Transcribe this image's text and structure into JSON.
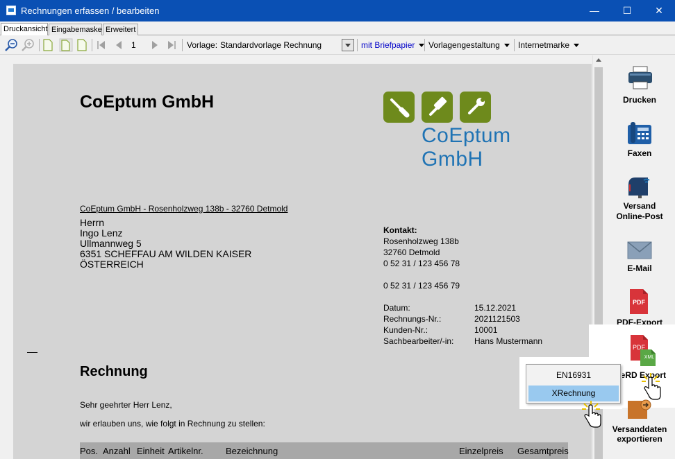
{
  "window": {
    "title": "Rechnungen erfassen / bearbeiten",
    "controls": {
      "minimize": "—",
      "maximize": "☐",
      "close": "✕"
    }
  },
  "tabs": [
    {
      "label": "Druckansicht",
      "active": true
    },
    {
      "label": "Eingabemaske",
      "active": false
    },
    {
      "label": "Erweitert",
      "active": false
    }
  ],
  "toolbar": {
    "page_number": "1",
    "vorlage_label": "Vorlage:",
    "vorlage_value": "Standardvorlage Rechnung",
    "briefpapier": "mit Briefpapier",
    "vorlagengestaltung": "Vorlagengestaltung",
    "internetmarke": "Internetmarke"
  },
  "document": {
    "company_title": "CoEptum GmbH",
    "logo_text": "CoEptum GmbH",
    "sender_line": "CoEptum GmbH - Rosenholzweg 138b - 32760 Detmold",
    "recipient": [
      "Herrn",
      "Ingo Lenz",
      "Ullmannweg 5",
      "6351 SCHEFFAU AM WILDEN KAISER",
      "ÖSTERREICH"
    ],
    "kontakt_label": "Kontakt:",
    "kontakt": [
      "Rosenholzweg 138b",
      "32760 Detmold",
      "0 52 31 / 123 456 78"
    ],
    "fax": "0 52 31 / 123 456 79",
    "details": [
      {
        "label": "Datum:",
        "value": "15.12.2021"
      },
      {
        "label": "Rechnungs-Nr.:",
        "value": "2021121503"
      },
      {
        "label": "Kunden-Nr.:",
        "value": "10001"
      },
      {
        "label": "Sachbearbeiter/-in:",
        "value": "Hans Mustermann"
      }
    ],
    "heading": "Rechnung",
    "salutation": "Sehr geehrter Herr Lenz,",
    "intro": "wir erlauben uns, wie folgt in Rechnung zu stellen:",
    "table_headers": [
      "Pos.",
      "Anzahl",
      "Einheit",
      "Artikelnr.",
      "Bezeichnung",
      "Einzelpreis",
      "Gesamtpreis"
    ]
  },
  "right_panel": {
    "drucken": "Drucken",
    "faxen": "Faxen",
    "versand_line1": "Versand",
    "versand_line2": "Online-Post",
    "email": "E-Mail",
    "pdf_export": "PDF-Export",
    "zugferd_export": "ZUGFeRD Export",
    "versanddaten_line1": "Versanddaten",
    "versanddaten_line2": "exportieren",
    "pdf_badge": "PDF",
    "xml_badge": "XML"
  },
  "popup_menu": [
    {
      "label": "EN16931",
      "selected": false
    },
    {
      "label": "XRechnung",
      "selected": true
    }
  ],
  "colors": {
    "titlebar": "#0a50b4",
    "logo_green": "#6e8a1c",
    "logo_blue": "#1f73b4",
    "menu_selected": "#99c9ef",
    "pdf_red": "#d8343a"
  }
}
